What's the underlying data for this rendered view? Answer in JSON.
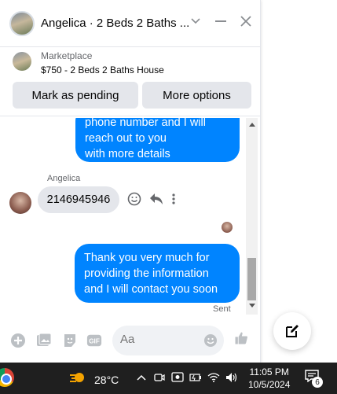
{
  "header": {
    "title": "Angelica · 2 Beds 2 Baths ...",
    "icons": [
      "house-avatar",
      "chevron-down-icon",
      "minimize-icon",
      "close-icon"
    ]
  },
  "listing": {
    "source": "Marketplace",
    "title": "$750 - 2 Beds 2 Baths House",
    "mark_pending_label": "Mark as pending",
    "more_options_label": "More options"
  },
  "messages": {
    "outgoing_1": {
      "line1": "phone number and I will",
      "line2": "reach out to you",
      "line3": "with more details"
    },
    "sender_name": "Angelica",
    "incoming_1": "2146945946",
    "outgoing_2": {
      "line1": "Thank you very much for",
      "line2": "providing the information",
      "line3": "and I will contact you soon"
    },
    "status": "Sent"
  },
  "composer": {
    "placeholder": "Aa",
    "icons": [
      "plus-icon",
      "photo-icon",
      "sticker-icon",
      "gif-icon",
      "emoji-icon",
      "like-icon"
    ]
  },
  "taskbar": {
    "temperature": "28°C",
    "time": "11:05 PM",
    "date": "10/5/2024",
    "notification_count": "6"
  },
  "colors": {
    "accent": "#0084ff",
    "bubble_in": "#e4e6eb",
    "taskbar": "#1f1f1f"
  }
}
